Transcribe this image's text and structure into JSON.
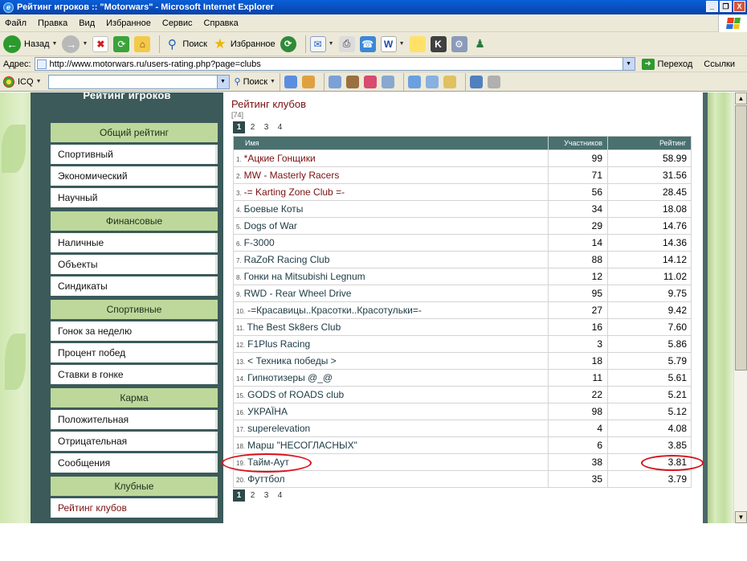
{
  "window": {
    "title": "Рейтинг игроков :: \"Motorwars\" - Microsoft Internet Explorer",
    "controls": [
      "_",
      "❐",
      "X"
    ]
  },
  "menubar": [
    "Файл",
    "Правка",
    "Вид",
    "Избранное",
    "Сервис",
    "Справка"
  ],
  "toolbar": {
    "back": "Назад",
    "search": "Поиск",
    "favorites": "Избранное"
  },
  "addressbar": {
    "label": "Адрес:",
    "url": "http://www.motorwars.ru/users-rating.php?page=clubs",
    "go": "Переход",
    "links": "Ссылки"
  },
  "icqbar": {
    "label": "ICQ",
    "search": "Поиск"
  },
  "sidebar": {
    "title": "Рейтинг игроков",
    "groups": [
      {
        "title": "Общий рейтинг",
        "items": [
          "Спортивный",
          "Экономический",
          "Научный"
        ]
      },
      {
        "title": "Финансовые",
        "items": [
          "Наличные",
          "Объекты",
          "Синдикаты"
        ]
      },
      {
        "title": "Спортивные",
        "items": [
          "Гонок за неделю",
          "Процент побед",
          "Ставки в гонке"
        ]
      },
      {
        "title": "Карма",
        "items": [
          "Положительная",
          "Отрицательная",
          "Сообщения"
        ]
      },
      {
        "title": "Клубные",
        "items": [
          "Рейтинг клубов"
        ]
      }
    ]
  },
  "content": {
    "title": "Рейтинг клубов",
    "count": "[74]",
    "pages": [
      "1",
      "2",
      "3",
      "4"
    ],
    "columns": {
      "name": "Имя",
      "members": "Участников",
      "rating": "Рейтинг"
    },
    "rows": [
      {
        "n": "1.",
        "name": "*Ацкие Гонщики",
        "members": "99",
        "rating": "58.99",
        "style": "red"
      },
      {
        "n": "2.",
        "name": "MW - Masterly Racers",
        "members": "71",
        "rating": "31.56",
        "style": "red"
      },
      {
        "n": "3.",
        "name": "-= Karting Zone Club =-",
        "members": "56",
        "rating": "28.45",
        "style": "red"
      },
      {
        "n": "4.",
        "name": "Боевые Коты",
        "members": "34",
        "rating": "18.08",
        "style": "dark"
      },
      {
        "n": "5.",
        "name": "Dogs of War",
        "members": "29",
        "rating": "14.76",
        "style": "dark"
      },
      {
        "n": "6.",
        "name": "F-3000",
        "members": "14",
        "rating": "14.36",
        "style": "dark"
      },
      {
        "n": "7.",
        "name": "RaZoR Racing Club",
        "members": "88",
        "rating": "14.12",
        "style": "dark"
      },
      {
        "n": "8.",
        "name": "Гонки на Mitsubishi Legnum",
        "members": "12",
        "rating": "11.02",
        "style": "dark"
      },
      {
        "n": "9.",
        "name": "RWD - Rear Wheel Drive",
        "members": "95",
        "rating": "9.75",
        "style": "dark"
      },
      {
        "n": "10.",
        "name": "-=Красавицы..Красотки..Красотульки=-",
        "members": "27",
        "rating": "9.42",
        "style": "dark"
      },
      {
        "n": "11.",
        "name": "The Best Sk8ers Club",
        "members": "16",
        "rating": "7.60",
        "style": "dark"
      },
      {
        "n": "12.",
        "name": "F1Plus Racing",
        "members": "3",
        "rating": "5.86",
        "style": "dark"
      },
      {
        "n": "13.",
        "name": "< Техника победы >",
        "members": "18",
        "rating": "5.79",
        "style": "dark"
      },
      {
        "n": "14.",
        "name": "Гипнотизеры @_@",
        "members": "11",
        "rating": "5.61",
        "style": "dark"
      },
      {
        "n": "15.",
        "name": "GODS of ROADS club",
        "members": "22",
        "rating": "5.21",
        "style": "dark"
      },
      {
        "n": "16.",
        "name": "УКРАЇНА",
        "members": "98",
        "rating": "5.12",
        "style": "dark"
      },
      {
        "n": "17.",
        "name": "superelevation",
        "members": "4",
        "rating": "4.08",
        "style": "dark"
      },
      {
        "n": "18.",
        "name": "Марш \"НЕСОГЛАСНЫХ\"",
        "members": "6",
        "rating": "3.85",
        "style": "dark"
      },
      {
        "n": "19.",
        "name": "Тайм-Аут",
        "members": "38",
        "rating": "3.81",
        "style": "dark"
      },
      {
        "n": "20.",
        "name": "Футтбол",
        "members": "35",
        "rating": "3.79",
        "style": "dark"
      }
    ]
  },
  "colors": {
    "accent_red": "#7a1010",
    "sidebar_bg": "#3c5a5a",
    "menu_title_bg": "#bdd89a",
    "table_head_bg": "#4a7070",
    "highlight_ellipse": "#d8121c"
  }
}
